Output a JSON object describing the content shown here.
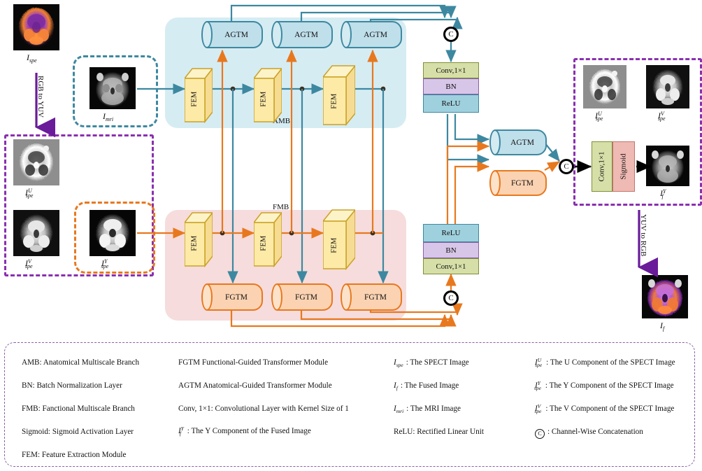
{
  "diagram": {
    "title": "Medical Image Fusion Network Architecture",
    "regions": {
      "amb_label": "AMB",
      "fmb_label": "FMB"
    },
    "modules": {
      "fem": "FEM",
      "agtm": "AGTM",
      "fgtm": "FGTM",
      "conv": "Conv,1×1",
      "bn": "BN",
      "relu": "ReLU",
      "sigmoid": "Sigmoid",
      "concat": "C"
    },
    "arrows": {
      "rgb_to_yuv": "RGB to YUV",
      "yuv_to_rgb": "YUV to RGB"
    },
    "images": [
      {
        "id": "spect",
        "cap_base": "I",
        "cap_sub": "spe",
        "cap_sup": ""
      },
      {
        "id": "mri",
        "cap_base": "I",
        "cap_sub": "mri",
        "cap_sup": ""
      },
      {
        "id": "spect_u",
        "cap_base": "I",
        "cap_sub": "spe",
        "cap_sup": "U"
      },
      {
        "id": "spect_v",
        "cap_base": "I",
        "cap_sub": "spe",
        "cap_sup": "V"
      },
      {
        "id": "spect_y",
        "cap_base": "I",
        "cap_sub": "spe",
        "cap_sup": "Y"
      },
      {
        "id": "out_u",
        "cap_base": "I",
        "cap_sub": "spe",
        "cap_sup": "U"
      },
      {
        "id": "out_v",
        "cap_base": "I",
        "cap_sub": "spe",
        "cap_sup": "V"
      },
      {
        "id": "fused_y",
        "cap_base": "I",
        "cap_sub": "f",
        "cap_sup": "Y"
      },
      {
        "id": "fused",
        "cap_base": "I",
        "cap_sub": "f",
        "cap_sup": ""
      }
    ],
    "legend": {
      "col1": [
        "AMB: Anatomical Multiscale Branch",
        "BN: Batch Normalization Layer",
        "FMB: Fanctional Multiscale Branch",
        "Sigmoid: Sigmoid Activation Layer",
        "FEM: Feature Extraction Module"
      ],
      "col2": [
        "FGTM Functional-Guided Transformer Module",
        "AGTM Anatomical-Guided Transformer Module",
        "Conv, 1×1: Convolutional Layer with Kernel Size of 1"
      ],
      "col2_sym": {
        "base": "I",
        "sub": "f",
        "sup": "Y",
        "desc": ": The Y Component of the Fused Image"
      },
      "col3": [
        {
          "base": "I",
          "sub": "spe",
          "sup": "",
          "desc": ": The SPECT Image"
        },
        {
          "base": "I",
          "sub": "f",
          "sup": "",
          "desc": ": The Fused Image"
        },
        {
          "base": "I",
          "sub": "mri",
          "sup": "",
          "desc": ": The MRI Image"
        }
      ],
      "col3_text": "ReLU: Rectified Linear Unit",
      "col4": [
        {
          "base": "I",
          "sub": "spe",
          "sup": "U",
          "desc": ": The U Component of the SPECT Image"
        },
        {
          "base": "I",
          "sub": "spe",
          "sup": "Y",
          "desc": ": The Y Component of the SPECT Image"
        },
        {
          "base": "I",
          "sub": "spe",
          "sup": "V",
          "desc": ": The V Component of the SPECT Image"
        }
      ],
      "col4_concat": ": Channel-Wise Concatenation"
    },
    "colors": {
      "anatomical": "#3d88a0",
      "functional": "#e8781e",
      "amb_region": "#d6ecf3",
      "fmb_region": "#f6dcdc",
      "fem_fill": "#fdeaa6",
      "fem_stroke": "#c9a227",
      "agtm_fill": "#bfdfea",
      "fgtm_fill": "#fbd3b2",
      "conv_fill": "#d6dfa8",
      "conv_stroke": "#7f8f35",
      "bn_fill": "#d7c6e8",
      "bn_stroke": "#8a5fa8",
      "relu_fill": "#9fd0dd",
      "sigmoid_fill": "#efb9b4",
      "sigmoid_stroke": "#c4756c",
      "purple_dash": "#8a2fb0",
      "black": "#000000"
    }
  }
}
